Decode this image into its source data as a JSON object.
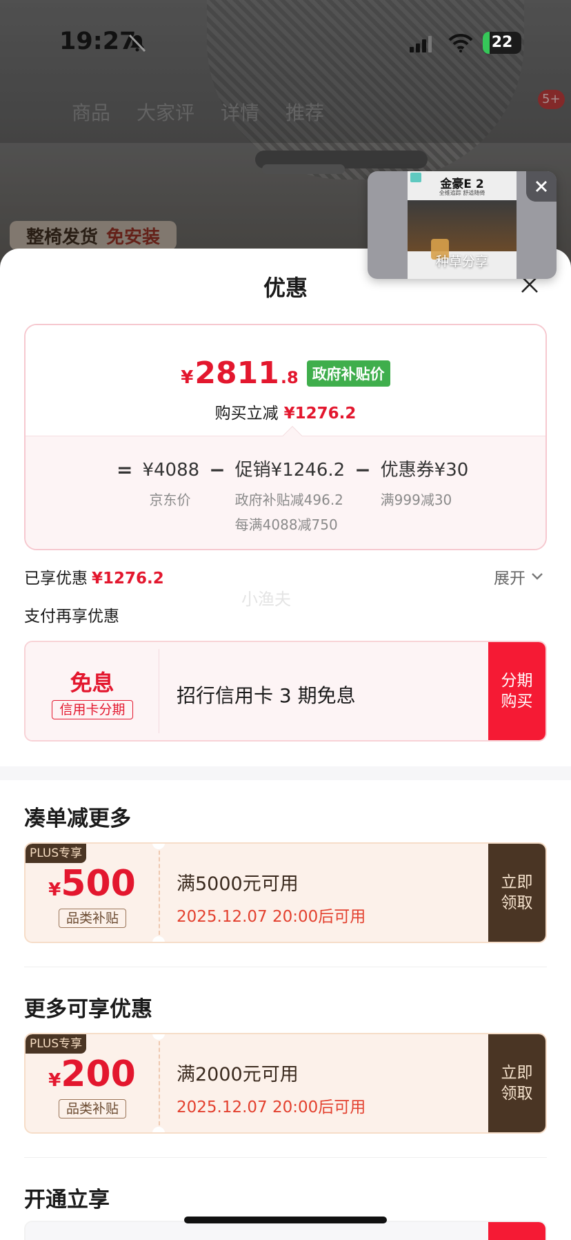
{
  "status_bar": {
    "time": "19:27",
    "battery": "22"
  },
  "background": {
    "tabs": [
      "商品",
      "大家评",
      "详情",
      "推荐"
    ],
    "cart_badge": "5+",
    "banner_left": "整椅发货",
    "banner_right": "免安装"
  },
  "float_video": {
    "title": "金豪E 2",
    "subtitle": "全维追踪 舒适随倚",
    "caption": "种草分享"
  },
  "sheet": {
    "title": "优惠",
    "final_price": {
      "currency": "¥",
      "integer": "2811",
      "decimal": ".8"
    },
    "gov_tag": "政府补贴价",
    "reduce_label": "购买立减",
    "reduce_amount": "¥1276.2",
    "formula": {
      "eq": "=",
      "base_value": "¥4088",
      "base_label": "京东价",
      "minus": "−",
      "promo_value": "促销¥1246.2",
      "promo_line1": "政府补贴减496.2",
      "promo_line2": "每满4088减750",
      "coupon_value": "优惠券¥30",
      "coupon_line": "满999减30"
    },
    "enjoyed_label": "已享优惠",
    "enjoyed_amount": "¥1276.2",
    "expand_label": "展开",
    "pay_more_label": "支付再享优惠",
    "watermark": "小渔夫",
    "credit_coupon": {
      "big": "免息",
      "tag": "信用卡分期",
      "text": "招行信用卡 3 期免息",
      "button": "分期\n购买"
    },
    "section1": {
      "title": "凑单减更多",
      "coupon": {
        "badge": "PLUS专享",
        "currency": "¥",
        "amount": "500",
        "tag": "品类补贴",
        "condition": "满5000元可用",
        "date": "2025.12.07 20:00后可用",
        "button": "立即\n领取"
      }
    },
    "section2": {
      "title": "更多可享优惠",
      "coupon": {
        "badge": "PLUS专享",
        "currency": "¥",
        "amount": "200",
        "tag": "品类补贴",
        "condition": "满2000元可用",
        "date": "2025.12.07 20:00后可用",
        "button": "立即\n领取"
      }
    },
    "section3": {
      "title": "开通立享"
    }
  },
  "colors": {
    "accent_red": "#e3172e",
    "gov_green": "#3fae4c",
    "plus_brown": "#4a3524",
    "button_red": "#f51a34"
  },
  "icons": [
    "bell-slash-icon",
    "signal-icon",
    "wifi-icon",
    "battery-icon",
    "close-icon",
    "chevron-down-icon"
  ]
}
